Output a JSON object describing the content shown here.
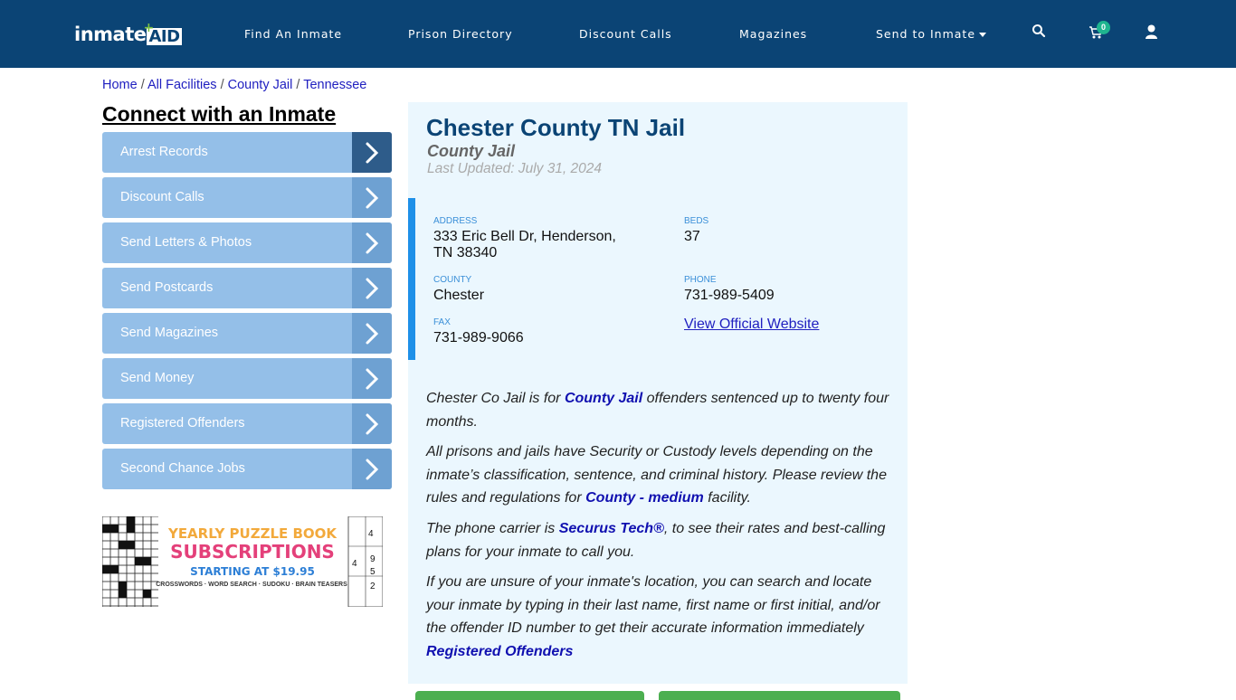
{
  "header": {
    "logo": {
      "text_left": "inmate",
      "text_right": "AID"
    },
    "nav": [
      {
        "label": "Find An Inmate"
      },
      {
        "label": "Prison Directory"
      },
      {
        "label": "Discount Calls"
      },
      {
        "label": "Magazines"
      },
      {
        "label": "Send to Inmate",
        "has_dropdown": true
      }
    ],
    "icons": {
      "search": "search-icon",
      "cart": "cart-icon",
      "user": "user-icon"
    },
    "cart_count": "0"
  },
  "breadcrumb": [
    {
      "label": "Home"
    },
    {
      "label": "All Facilities"
    },
    {
      "label": "County Jail"
    },
    {
      "label": "Tennessee"
    }
  ],
  "breadcrumb_sep": "/",
  "sidebar": {
    "title": "Connect with an Inmate",
    "items": [
      {
        "label": "Arrest Records",
        "active": true
      },
      {
        "label": "Discount Calls"
      },
      {
        "label": "Send Letters & Photos"
      },
      {
        "label": "Send Postcards"
      },
      {
        "label": "Send Magazines"
      },
      {
        "label": "Send Money"
      },
      {
        "label": "Registered Offenders"
      },
      {
        "label": "Second Chance Jobs"
      }
    ],
    "ad": {
      "line1": "YEARLY PUZZLE BOOK",
      "line2": "SUBSCRIPTIONS",
      "line3": "STARTING AT $19.95",
      "line4": "CROSSWORDS · WORD SEARCH · SUDOKU · BRAIN TEASERS"
    }
  },
  "facility": {
    "title": "Chester County TN Jail",
    "type": "County Jail",
    "last_updated": "Last Updated: July 31, 2024",
    "address_label": "ADDRESS",
    "address_line1": "333 Eric Bell Dr, Henderson,",
    "address_line2": "TN 38340",
    "beds_label": "BEDS",
    "beds": "37",
    "county_label": "COUNTY",
    "county": "Chester",
    "phone_label": "PHONE",
    "phone": "731-989-5409",
    "fax_label": "FAX",
    "fax": "731-989-9066",
    "website_link": "View Official Website"
  },
  "description": {
    "p1_a": "Chester Co Jail is for ",
    "p1_link": "County Jail",
    "p1_b": " offenders sentenced up to twenty four months.",
    "p2_a": "All prisons and jails have Security or Custody levels depending on the inmate’s classification, sentence, and criminal history. Please review the rules and regulations for ",
    "p2_link": "County - medium",
    "p2_b": " facility.",
    "p3_a": "The phone carrier is ",
    "p3_link": "Securus Tech®",
    "p3_b": ", to see their rates and best-calling plans for your inmate to call you.",
    "p4": "If you are unsure of your inmate's location, you can search and locate your inmate by typing in their last name, first name or first initial, and/or the offender ID number to get their accurate information immediately",
    "p4_link": "Registered Offenders"
  },
  "colors": {
    "header_bg": "#0b4475",
    "sidebar_item": "#94bfe8",
    "sidebar_arrow": "#6ea1d2",
    "sidebar_arrow_active": "#2e5c8a",
    "card_bg": "#ebf7fe",
    "accent_bar": "#1e90e8",
    "green_button": "#4caf50"
  }
}
